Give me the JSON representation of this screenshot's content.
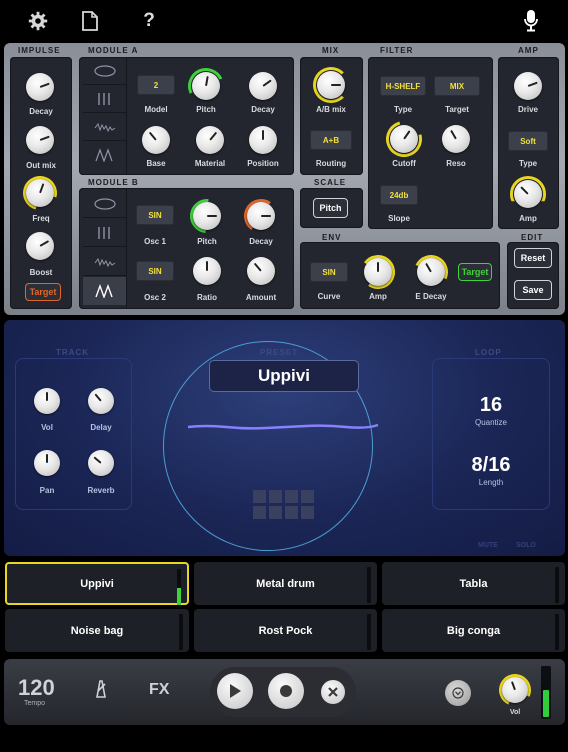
{
  "toolbar": {
    "settings_icon": "gear-icon",
    "document_icon": "document-icon",
    "help_label": "?",
    "mic_icon": "microphone-icon"
  },
  "sections": {
    "impulse": "IMPULSE",
    "module_a": "MODULE A",
    "module_b": "MODULE B",
    "mix": "MIX",
    "filter": "FILTER",
    "amp": "AMP",
    "scale": "SCALE",
    "env": "ENV",
    "edit": "EDIT"
  },
  "impulse": {
    "decay": "Decay",
    "out_mix": "Out mix",
    "freq": "Freq",
    "boost": "Boost",
    "target": "Target"
  },
  "module_a": {
    "model_value": "2",
    "model": "Model",
    "pitch": "Pitch",
    "decay": "Decay",
    "base": "Base",
    "material": "Material",
    "position": "Position"
  },
  "module_b": {
    "osc1_value": "SIN",
    "osc1": "Osc 1",
    "pitch": "Pitch",
    "decay": "Decay",
    "osc2_value": "SIN",
    "osc2": "Osc 2",
    "ratio": "Ratio",
    "amount": "Amount"
  },
  "mix": {
    "ab_mix": "A/B mix",
    "routing_value": "A+B",
    "routing": "Routing"
  },
  "scale": {
    "pitch": "Pitch"
  },
  "filter": {
    "type_value": "H-SHELF",
    "type": "Type",
    "target_value": "MIX",
    "target": "Target",
    "cutoff": "Cutoff",
    "reso": "Reso",
    "slope_value": "24db",
    "slope": "Slope"
  },
  "amp": {
    "drive": "Drive",
    "type_value": "Soft",
    "type": "Type",
    "amp": "Amp"
  },
  "env": {
    "curve_value": "SIN",
    "curve": "Curve",
    "amp": "Amp",
    "e_decay": "E Decay",
    "target": "Target"
  },
  "edit": {
    "reset": "Reset",
    "save": "Save"
  },
  "track": {
    "label": "TRACK",
    "vol": "Vol",
    "delay": "Delay",
    "pan": "Pan",
    "reverb": "Reverb"
  },
  "preset": {
    "label": "PRESET",
    "name": "Uppivi"
  },
  "loop": {
    "label": "LOOP",
    "quantize_value": "16",
    "quantize": "Quantize",
    "length_value": "8/16",
    "length": "Length"
  },
  "mute_solo": {
    "mute": "MUTE",
    "solo": "SOLO"
  },
  "pads": [
    "Uppivi",
    "Metal drum",
    "Tabla",
    "Noise bag",
    "Rost Pock",
    "Big conga"
  ],
  "transport": {
    "tempo_value": "120",
    "tempo": "Tempo",
    "fx": "FX",
    "vol": "Vol",
    "level": 0.55
  },
  "colors": {
    "accent_yellow": "#f2e13c",
    "accent_green": "#3fd23a",
    "accent_orange": "#e0672a",
    "ring": "#5da9d6"
  }
}
